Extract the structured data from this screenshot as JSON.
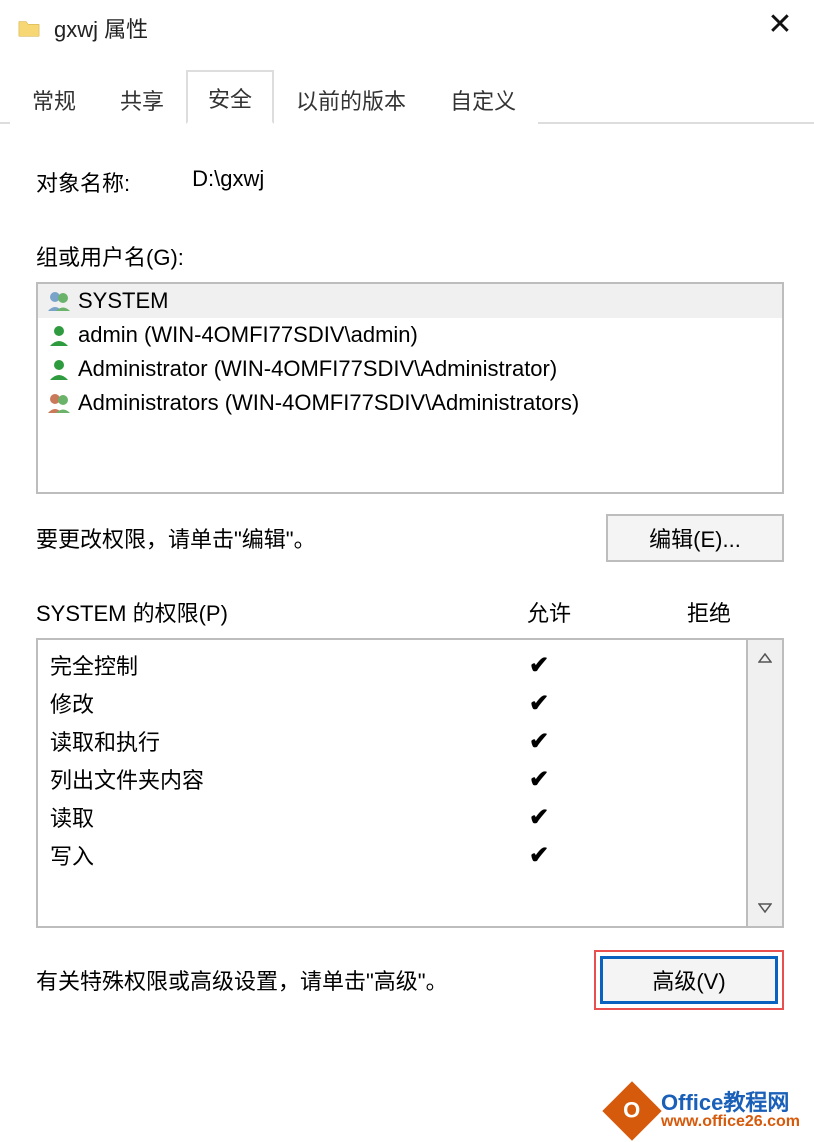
{
  "titlebar": {
    "title": "gxwj 属性",
    "close": "✕"
  },
  "tabs": [
    {
      "label": "常规"
    },
    {
      "label": "共享"
    },
    {
      "label": "安全"
    },
    {
      "label": "以前的版本"
    },
    {
      "label": "自定义"
    }
  ],
  "active_tab": 2,
  "object": {
    "label": "对象名称:",
    "value": "D:\\gxwj"
  },
  "groups": {
    "label": "组或用户名(G):",
    "items": [
      {
        "name": "SYSTEM",
        "icon": "group"
      },
      {
        "name": "admin (WIN-4OMFI77SDIV\\admin)",
        "icon": "user"
      },
      {
        "name": "Administrator (WIN-4OMFI77SDIV\\Administrator)",
        "icon": "user"
      },
      {
        "name": "Administrators (WIN-4OMFI77SDIV\\Administrators)",
        "icon": "group"
      }
    ],
    "selected": 0
  },
  "edit": {
    "text": "要更改权限，请单击\"编辑\"。",
    "button": "编辑(E)..."
  },
  "permissions": {
    "header_for": "SYSTEM 的权限(P)",
    "col_allow": "允许",
    "col_deny": "拒绝",
    "rows": [
      {
        "name": "完全控制",
        "allow": true,
        "deny": false
      },
      {
        "name": "修改",
        "allow": true,
        "deny": false
      },
      {
        "name": "读取和执行",
        "allow": true,
        "deny": false
      },
      {
        "name": "列出文件夹内容",
        "allow": true,
        "deny": false
      },
      {
        "name": "读取",
        "allow": true,
        "deny": false
      },
      {
        "name": "写入",
        "allow": true,
        "deny": false
      }
    ]
  },
  "advanced": {
    "text": "有关特殊权限或高级设置，请单击\"高级\"。",
    "button": "高级(V)"
  },
  "watermark": {
    "badge": "O",
    "line1": "Office教程网",
    "line2": "www.office26.com"
  }
}
